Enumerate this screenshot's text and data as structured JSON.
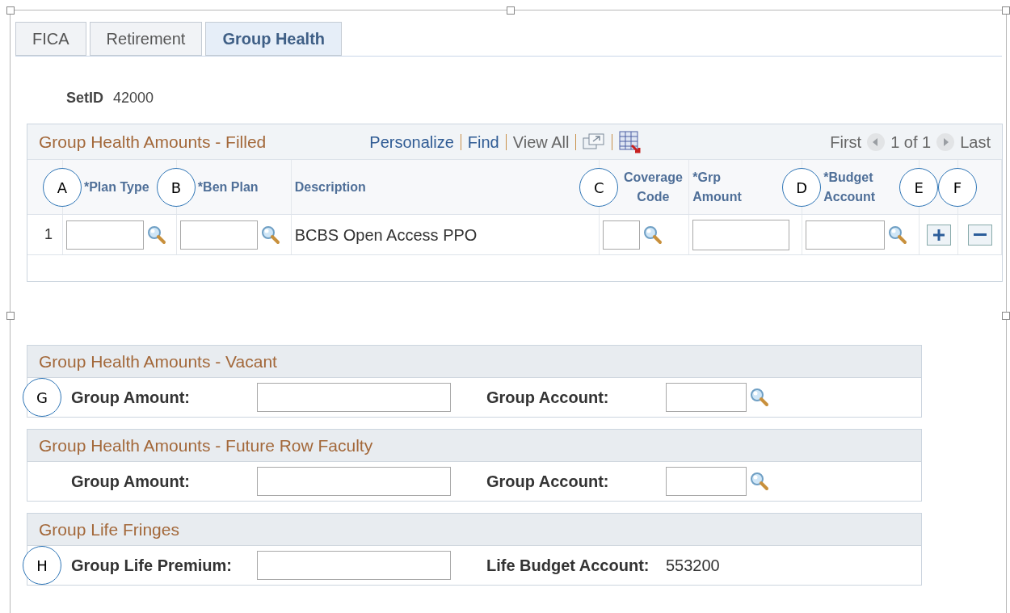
{
  "tabs": [
    {
      "label": "FICA",
      "selected": false
    },
    {
      "label": "Retirement",
      "selected": false
    },
    {
      "label": "Group Health",
      "selected": true
    }
  ],
  "setid": {
    "label": "SetID",
    "value": "42000"
  },
  "grid": {
    "title": "Group Health Amounts - Filled",
    "links": [
      "Personalize",
      "Find"
    ],
    "view_all": "View All",
    "first": "First",
    "count": "1 of 1",
    "last": "Last",
    "columns": [
      {
        "kind": "rownum",
        "callout": "A"
      },
      {
        "kind": "lookup",
        "label": "*Plan Type",
        "callout": "B"
      },
      {
        "kind": "lookup",
        "label": "*Ben Plan"
      },
      {
        "kind": "text",
        "label": "Description",
        "callout": "C"
      },
      {
        "kind": "lookup",
        "label": "Coverage Code"
      },
      {
        "kind": "input",
        "label": "*Grp Amount",
        "callout": "D"
      },
      {
        "kind": "lookup",
        "label": "*Budget Account",
        "callout": "E"
      },
      {
        "kind": "add",
        "callout": "F"
      },
      {
        "kind": "delete"
      }
    ],
    "rows": [
      {
        "number": "1",
        "description": "BCBS Open Access PPO"
      }
    ]
  },
  "sections": [
    {
      "title": "Group Health Amounts - Vacant",
      "callout": "G",
      "fields": [
        {
          "label": "Group Amount:",
          "kind": "input"
        },
        {
          "label": "Group Account:",
          "kind": "lookup"
        }
      ]
    },
    {
      "title": "Group Health Amounts - Future Row Faculty",
      "fields": [
        {
          "label": "Group Amount:",
          "kind": "input"
        },
        {
          "label": "Group Account:",
          "kind": "lookup"
        }
      ]
    },
    {
      "title": "Group Life Fringes",
      "callout": "H",
      "fields": [
        {
          "label": "Group Life Premium:",
          "kind": "input"
        },
        {
          "label": "Life Budget Account:",
          "kind": "readonly",
          "value": "553200"
        }
      ]
    }
  ]
}
